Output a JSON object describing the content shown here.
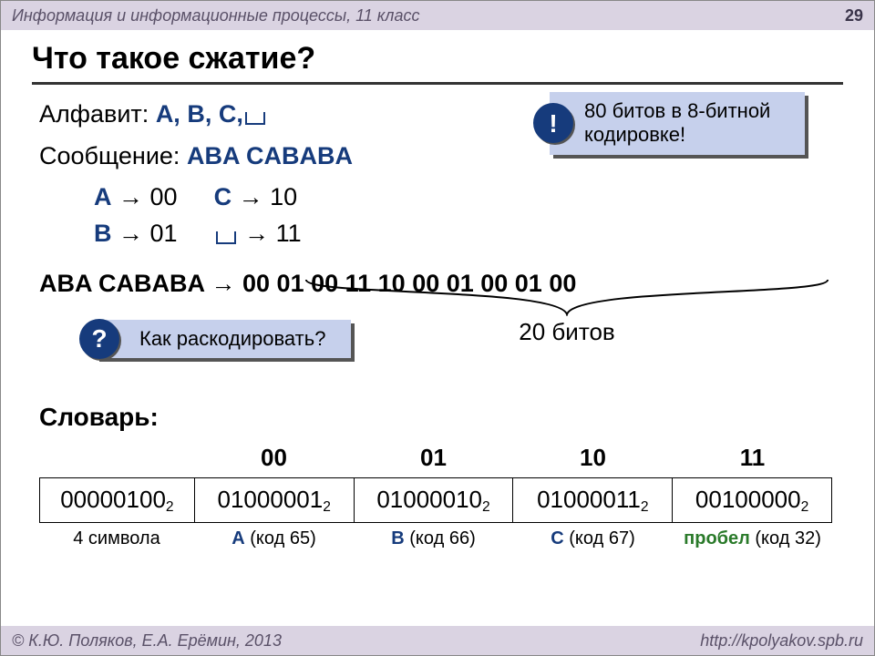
{
  "header": {
    "course": "Информация и информационные процессы, 11 класс",
    "page": "29"
  },
  "footer": {
    "authors": "© К.Ю. Поляков, Е.А. Ерёмин, 2013",
    "url": "http://kpolyakov.spb.ru"
  },
  "title": "Что такое сжатие?",
  "alphabet": {
    "label": "Алфавит:",
    "letters": "A, B, C,"
  },
  "message": {
    "label": "Сообщение:",
    "text": "ABA CABABA"
  },
  "callout_bits": {
    "icon": "!",
    "text": "80 битов в 8-битной кодировке!"
  },
  "callout_decode": {
    "icon": "?",
    "text": "Как раскодировать?"
  },
  "codes": {
    "a": {
      "sym": "A",
      "code": "00"
    },
    "b": {
      "sym": "B",
      "code": "01"
    },
    "c": {
      "sym": "C",
      "code": "10"
    },
    "sp": {
      "code": "11"
    }
  },
  "encoded": {
    "src": "ABA CABABA",
    "bits": "00 01 00 11 10 00 01 00 01 00"
  },
  "brace_label": "20 битов",
  "dict": {
    "label": "Словарь:",
    "headers": [
      "00",
      "01",
      "10",
      "11"
    ],
    "row": [
      "00000100",
      "01000001",
      "01000010",
      "01000011",
      "00100000"
    ],
    "base": "2",
    "desc": [
      {
        "t": "4 символа",
        "cls": ""
      },
      {
        "pre": "A",
        "t": " (код 65)",
        "cls": "navy"
      },
      {
        "pre": "B",
        "t": " (код 66)",
        "cls": "navy"
      },
      {
        "pre": "C",
        "t": " (код 67)",
        "cls": "navy"
      },
      {
        "pre": "пробел",
        "t": " (код 32)",
        "cls": "green"
      }
    ]
  }
}
